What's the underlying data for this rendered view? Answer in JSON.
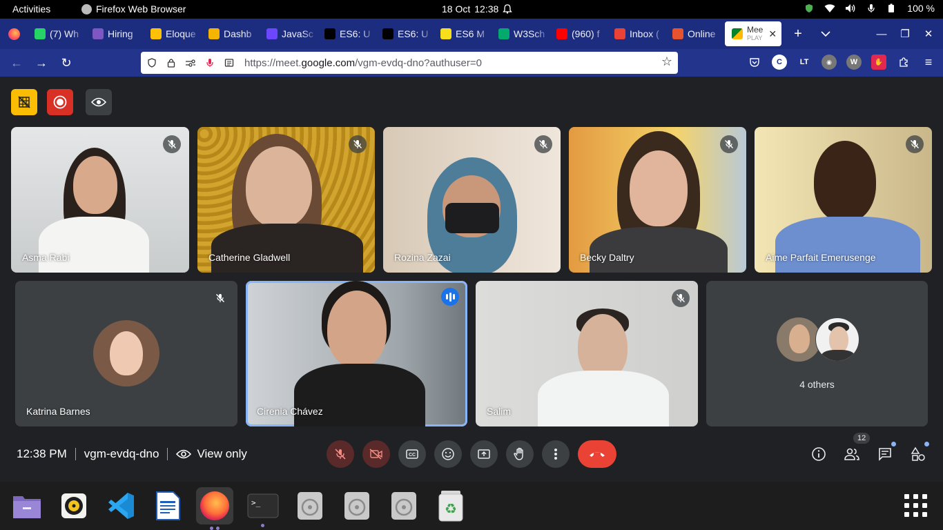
{
  "system": {
    "activities": "Activities",
    "app_name": "Firefox Web Browser",
    "date": "18 Oct",
    "time": "12:38",
    "battery": "100 %"
  },
  "tabs": [
    {
      "title": "(7) Wh",
      "favicon": "whatsapp-icon",
      "color": "#25d366"
    },
    {
      "title": "Hiring",
      "favicon": "grid-icon",
      "color": "#7e57c2"
    },
    {
      "title": "Eloque",
      "favicon": "ejs-icon",
      "color": "#ffc107"
    },
    {
      "title": "Dashb",
      "favicon": "owl-icon",
      "color": "#f4b400"
    },
    {
      "title": "JavaSc",
      "favicon": "js-icon",
      "color": "#6c47ff"
    },
    {
      "title": "ES6: U",
      "favicon": "angular-icon",
      "color": "#000000"
    },
    {
      "title": "ES6: U",
      "favicon": "angular-icon",
      "color": "#000000"
    },
    {
      "title": "ES6 M",
      "favicon": "js-badge-icon",
      "color": "#f7df1e"
    },
    {
      "title": "W3Sch",
      "favicon": "w3schools-icon",
      "color": "#04aa6d"
    },
    {
      "title": "(960) f",
      "favicon": "youtube-icon",
      "color": "#ff0000"
    },
    {
      "title": "Inbox (",
      "favicon": "gmail-icon",
      "color": "#ea4335"
    },
    {
      "title": "Online",
      "favicon": "edge-icon",
      "color": "#e8532f"
    }
  ],
  "active_tab": {
    "title_line1": "Mee",
    "title_line2": "PLAY"
  },
  "url": {
    "prefix": "https://meet.",
    "domain": "google.com",
    "path": "/vgm-evdq-dno?authuser=0"
  },
  "participants": [
    {
      "name": "Asma Rabi",
      "muted": true
    },
    {
      "name": "Catherine Gladwell",
      "muted": true
    },
    {
      "name": "Rozina Zazai",
      "muted": true
    },
    {
      "name": "Becky Daltry",
      "muted": true
    },
    {
      "name": "Aime Parfait Emerusenge",
      "muted": true
    },
    {
      "name": "Katrina Barnes",
      "muted": true
    },
    {
      "name": "Cirenia Chávez",
      "speaking": true
    },
    {
      "name": "Salim",
      "muted": true
    }
  ],
  "others": {
    "label": "4 others"
  },
  "meeting": {
    "time": "12:38 PM",
    "code": "vgm-evdq-dno",
    "view_label": "View only",
    "participant_count": "12"
  },
  "colors": {
    "brand_blue": "#1c2c7e",
    "end_call": "#ea4335",
    "speaking_outline": "#8ab4f8"
  }
}
